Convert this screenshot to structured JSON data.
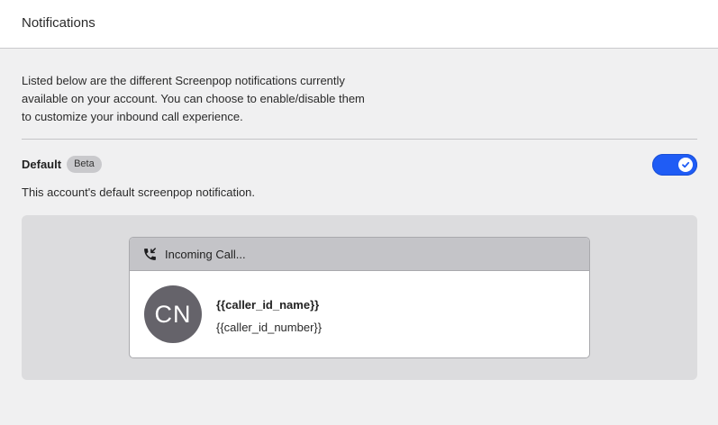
{
  "header": {
    "title": "Notifications"
  },
  "intro": {
    "text": "Listed below are the different Screenpop notifications currently available on your account. You can choose to enable/disable them to customize your inbound call experience."
  },
  "notification": {
    "name": "Default",
    "badge": "Beta",
    "description": "This account's default screenpop notification.",
    "enabled": true,
    "toggle_color": "#1f5cf5"
  },
  "preview": {
    "header_label": "Incoming Call...",
    "header_icon": "incoming-call-icon",
    "avatar_initials": "CN",
    "avatar_color": "#65636a",
    "caller_name": "{{caller_id_name}}",
    "caller_number": "{{caller_id_number}}"
  }
}
